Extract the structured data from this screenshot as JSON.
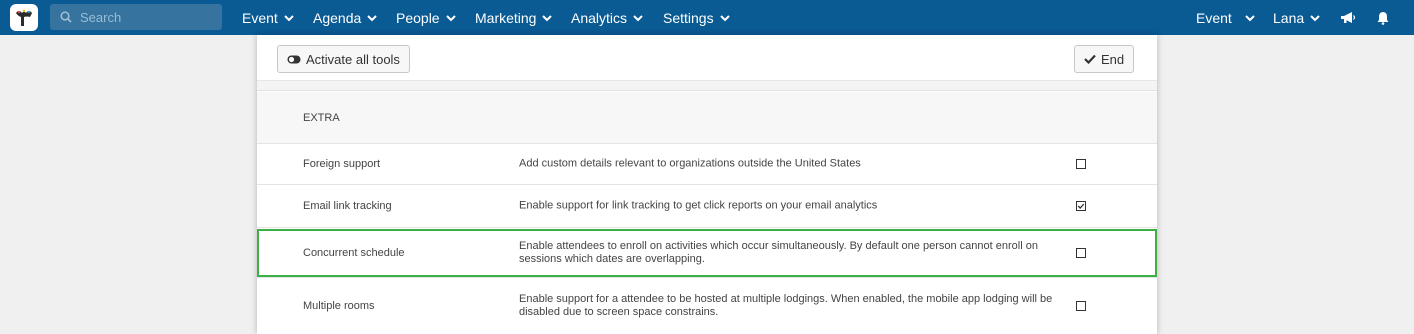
{
  "header": {
    "search_placeholder": "Search",
    "nav": [
      {
        "label": "Event"
      },
      {
        "label": "Agenda"
      },
      {
        "label": "People"
      },
      {
        "label": "Marketing"
      },
      {
        "label": "Analytics"
      },
      {
        "label": "Settings"
      }
    ],
    "right": {
      "event_label": "Event",
      "user_label": "Lana"
    },
    "colors": {
      "bar": "#0a5a94",
      "accent_highlight": "#3cb045"
    }
  },
  "toolbar": {
    "activate_label": "Activate all tools",
    "end_label": "End"
  },
  "section": {
    "title": "EXTRA"
  },
  "tools": [
    {
      "name": "Foreign support",
      "description": "Add custom details relevant to organizations outside the United States",
      "checked": false
    },
    {
      "name": "Email link tracking",
      "description": "Enable support for link tracking to get click reports on your email analytics",
      "checked": true
    },
    {
      "name": "Concurrent schedule",
      "description": "Enable attendees to enroll on activities which occur simultaneously. By default one person cannot enroll on sessions which dates are overlapping.",
      "checked": false
    },
    {
      "name": "Multiple rooms",
      "description": "Enable support for a attendee to be hosted at multiple lodgings. When enabled, the mobile app lodging will be disabled due to screen space constrains.",
      "checked": false
    }
  ]
}
